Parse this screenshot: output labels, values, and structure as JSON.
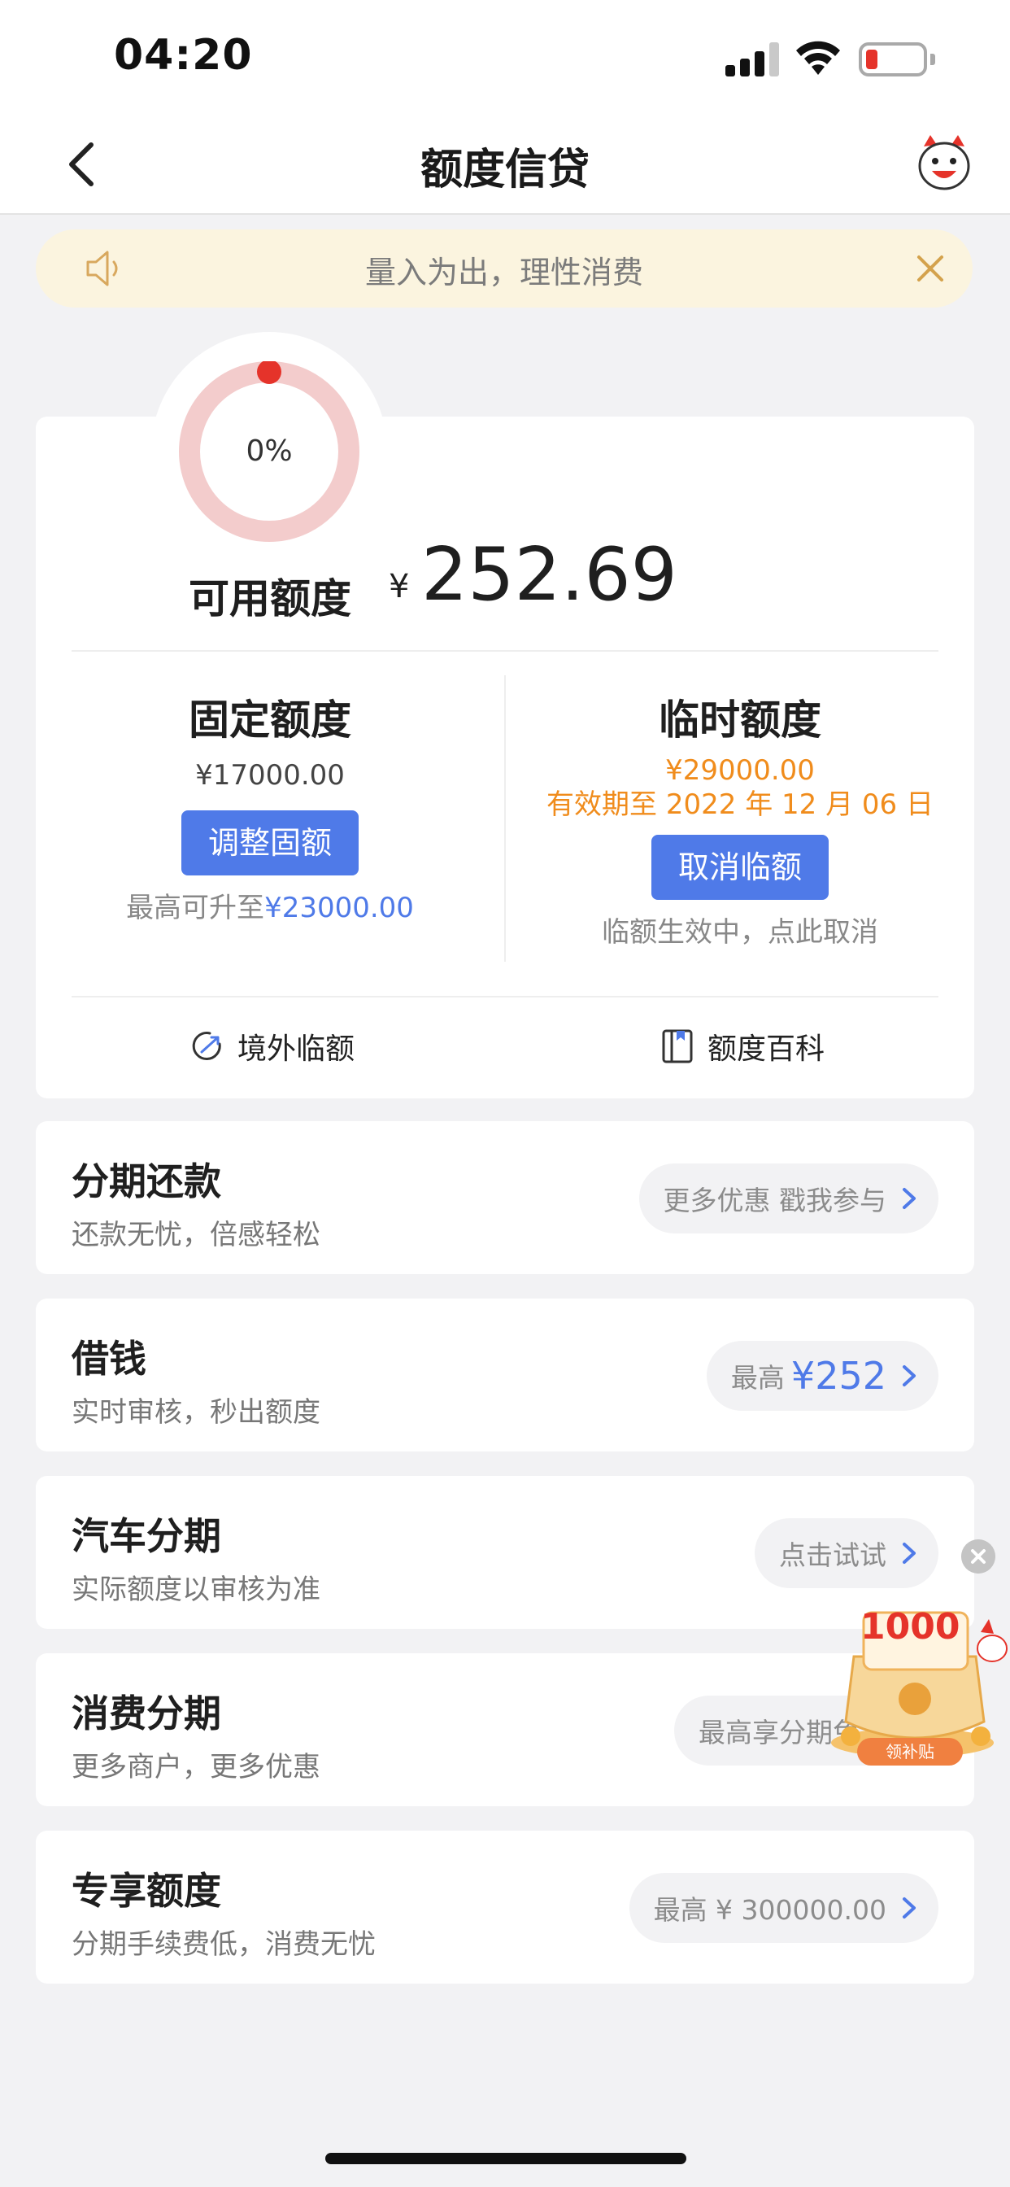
{
  "status_bar": {
    "time": "04:20"
  },
  "nav": {
    "title": "额度信贷"
  },
  "notice": {
    "text": "量入为出，理性消费"
  },
  "usage": {
    "percent_label": "0%",
    "fraction_used": 0.0
  },
  "available": {
    "label": "可用额度",
    "currency": "¥",
    "amount": "252.69"
  },
  "fixed_limit": {
    "title": "固定额度",
    "amount": "¥17000.00",
    "button": "调整固额",
    "note_prefix": "最高可升至",
    "note_value": "¥23000.00"
  },
  "temp_limit": {
    "title": "临时额度",
    "amount": "¥29000.00",
    "expiry": "有效期至 2022 年 12 月 06 日",
    "button": "取消临额",
    "note": "临额生效中，点此取消"
  },
  "links": {
    "overseas": "境外临额",
    "wiki": "额度百科"
  },
  "services": [
    {
      "title": "分期还款",
      "subtitle": "还款无忧，倍感轻松",
      "pill": "更多优惠 戳我参与"
    },
    {
      "title": "借钱",
      "subtitle": "实时审核，秒出额度",
      "pill_prefix": "最高",
      "pill_value": "¥252"
    },
    {
      "title": "汽车分期",
      "subtitle": "实际额度以审核为准",
      "pill": "点击试试"
    },
    {
      "title": "消费分期",
      "subtitle": "更多商户，更多优惠",
      "pill": "最高享分期免费"
    },
    {
      "title": "专享额度",
      "subtitle": "分期手续费低，消费无忧",
      "pill": "最高 ¥ 300000.00"
    }
  ],
  "promo": {
    "amount": "1000",
    "label": "领补贴"
  },
  "colors": {
    "accent_blue": "#4f7ae8",
    "accent_orange": "#f08c1c",
    "ring": "#f3cccc",
    "ring_dot": "#e5332a"
  }
}
